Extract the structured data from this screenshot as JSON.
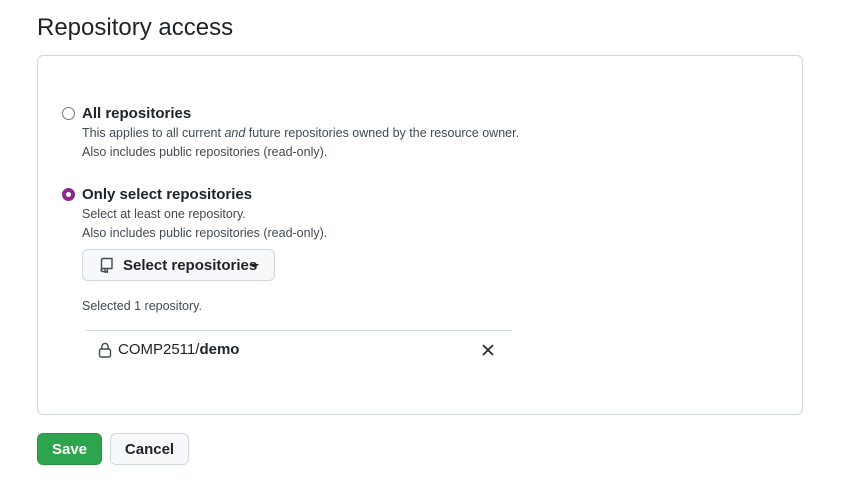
{
  "section": {
    "title": "Repository access"
  },
  "options": {
    "all": {
      "label": "All repositories",
      "desc_before": "This applies to all current ",
      "desc_emphasis": "and",
      "desc_after": " future repositories owned by the resource owner.",
      "desc_line2": "Also includes public repositories (read-only).",
      "checked": false
    },
    "select": {
      "label": "Only select repositories",
      "desc_line1": "Select at least one repository.",
      "desc_line2": "Also includes public repositories (read-only).",
      "checked": true
    }
  },
  "select_button": {
    "label": "Select repositories",
    "icon": "repo-icon"
  },
  "selection": {
    "count_text": "Selected 1 repository.",
    "repos": [
      {
        "owner": "COMP2511/",
        "name": "demo",
        "icon": "lock-icon"
      }
    ]
  },
  "actions": {
    "save_label": "Save",
    "cancel_label": "Cancel"
  },
  "colors": {
    "radio_accent": "#8a2a8c",
    "save_bg": "#2da44e",
    "border": "#d0d7de"
  }
}
